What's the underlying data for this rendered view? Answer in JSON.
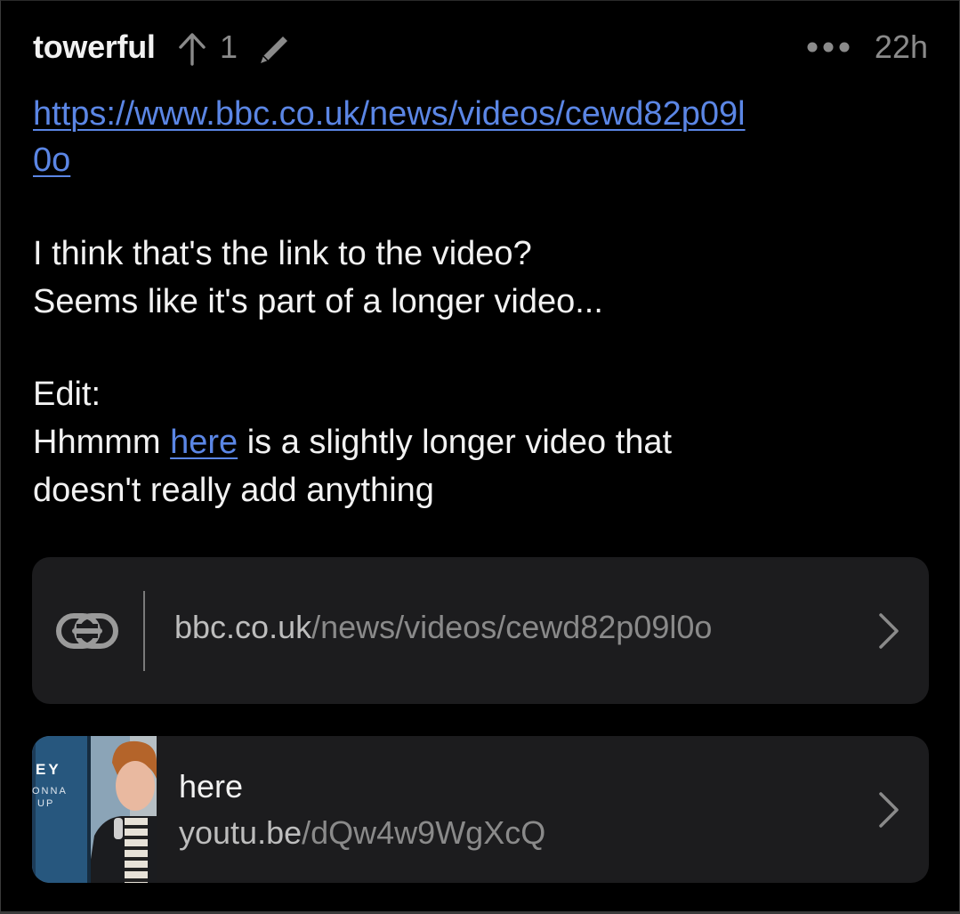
{
  "comment": {
    "author": "towerful",
    "score": "1",
    "time": "22h",
    "link_url_line1": "https://www.bbc.co.uk/news/videos/cewd82p09l",
    "link_url_line2": "0o",
    "paragraph1_line1": "I think that's the link to the video?",
    "paragraph1_line2": "Seems like it's part of a longer video...",
    "edit_label": "Edit:",
    "edit_prefix": "Hhmmm ",
    "edit_link_text": "here",
    "edit_suffix": " is a slightly longer video that",
    "edit_line2": "doesn't really add anything"
  },
  "icons": {
    "upvote": "arrow-up-icon",
    "edit": "pencil-icon",
    "more": "more-dots-icon",
    "link": "chain-link-icon",
    "chevron": "chevron-right-icon"
  },
  "cards": {
    "bbc": {
      "host": "bbc.co.uk",
      "path": "/news/videos/cewd82p09l0o"
    },
    "youtube": {
      "title": "here",
      "host": "youtu.be",
      "path": "/dQw4w9WgXcQ",
      "thumb_text_line1": "EY",
      "thumb_text_line2": "ONNA",
      "thumb_text_line3": "UP"
    }
  },
  "colors": {
    "background": "#000000",
    "card": "#1c1c1e",
    "link": "#5b86e5",
    "muted": "#8a8a8a",
    "text": "#f2f2f2"
  }
}
